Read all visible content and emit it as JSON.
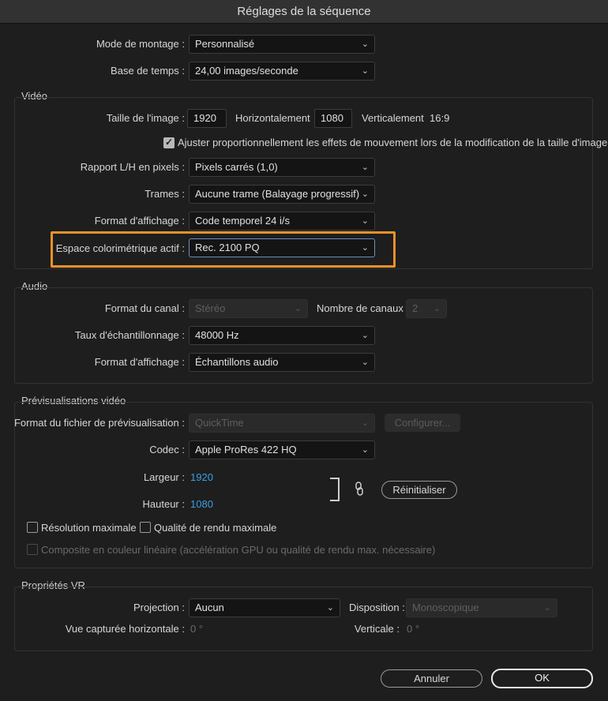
{
  "window": {
    "title": "Réglages de la séquence"
  },
  "general": {
    "editing_mode_label": "Mode de montage :",
    "editing_mode_value": "Personnalisé",
    "timebase_label": "Base de temps :",
    "timebase_value": "24,00  images/seconde"
  },
  "video": {
    "title": "Vidéo",
    "frame_size_label": "Taille de l'image :",
    "width_value": "1920",
    "horizontal_label": "Horizontalement",
    "height_value": "1080",
    "vertical_label": "Verticalement",
    "aspect_ratio": "16:9",
    "scale_effects_checked": true,
    "scale_effects_label": "Ajuster proportionnellement les effets de mouvement lors de la modification de la taille d'image",
    "pixel_aspect_label": "Rapport L/H en pixels :",
    "pixel_aspect_value": "Pixels carrés (1,0)",
    "fields_label": "Trames :",
    "fields_value": "Aucune trame (Balayage progressif)",
    "display_format_label": "Format d'affichage :",
    "display_format_value": "Code temporel 24 i/s",
    "color_space_label": "Espace colorimétrique actif :",
    "color_space_value": "Rec. 2100 PQ"
  },
  "audio": {
    "title": "Audio",
    "channel_format_label": "Format du canal :",
    "channel_format_value": "Stéréo",
    "channel_count_label": "Nombre de canaux :",
    "channel_count_value": "2",
    "sample_rate_label": "Taux d'échantillonnage :",
    "sample_rate_value": "48000 Hz",
    "display_format_label": "Format d'affichage :",
    "display_format_value": "Échantillons audio"
  },
  "preview": {
    "title": "Prévisualisations vidéo",
    "file_format_label": "Format du fichier de prévisualisation :",
    "file_format_value": "QuickTime",
    "configure_label": "Configurer...",
    "codec_label": "Codec :",
    "codec_value": "Apple ProRes 422 HQ",
    "width_label": "Largeur :",
    "width_value": "1920",
    "height_label": "Hauteur :",
    "height_value": "1080",
    "reset_label": "Réinitialiser",
    "max_bit_depth_checked": false,
    "max_bit_depth_label": "Résolution maximale",
    "max_render_quality_checked": false,
    "max_render_quality_label": "Qualité de rendu maximale",
    "linear_composite_checked": false,
    "linear_composite_label": "Composite en couleur linéaire (accélération GPU ou qualité de rendu max. nécessaire)"
  },
  "vr": {
    "title": "Propriétés VR",
    "projection_label": "Projection :",
    "projection_value": "Aucun",
    "layout_label": "Disposition :",
    "layout_value": "Monoscopique",
    "h_fov_label": "Vue capturée horizontale :",
    "h_fov_value": "0 °",
    "v_fov_label": "Verticale :",
    "v_fov_value": "0 °"
  },
  "footer": {
    "cancel_label": "Annuler",
    "ok_label": "OK"
  },
  "colors": {
    "highlight": "#e8922a",
    "link_value": "#3d9de6",
    "background": "#1e1e1e"
  }
}
